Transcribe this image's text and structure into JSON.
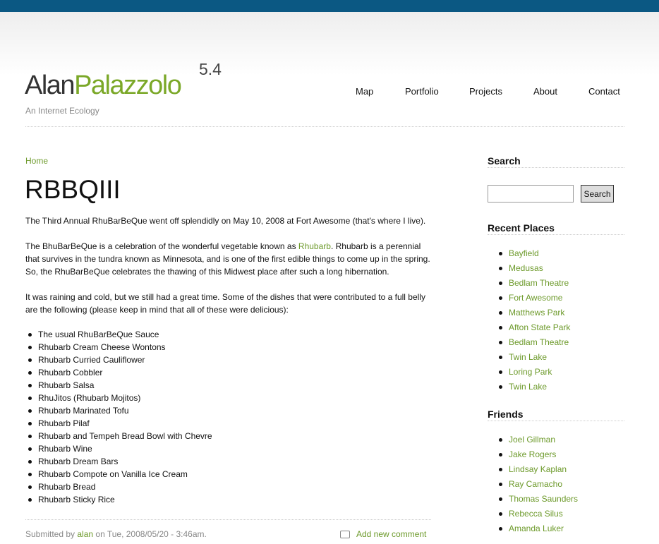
{
  "header": {
    "logo_first": "Alan",
    "logo_second": "Palazzolo",
    "version": "5.4",
    "tagline": "An Internet Ecology",
    "nav": [
      "Map",
      "Portfolio",
      "Projects",
      "About",
      "Contact"
    ]
  },
  "main": {
    "breadcrumb": "Home",
    "title": "RBBQIII",
    "para1": "The Third Annual RhuBarBeQue went off splendidly on May 10, 2008 at Fort Awesome (that's where I live).",
    "para2_before": "The BhuBarBeQue is a celebration of the wonderful vegetable known as ",
    "para2_link": "Rhubarb",
    "para2_after": ". Rhubarb is a perennial that survives in the tundra known as Minnesota, and is one of the first edible things to come up in the spring. So, the RhuBarBeQue celebrates the thawing of this Midwest place after such a long hibernation.",
    "para3": "It was raining and cold, but we still had a great time. Some of the dishes that were contributed to a full belly are the following (please keep in mind that all of these were delicious):",
    "dishes": [
      "The usual RhuBarBeQue Sauce",
      "Rhubarb Cream Cheese Wontons",
      "Rhubarb Curried Cauliflower",
      "Rhubarb Cobbler",
      "Rhubarb Salsa",
      "RhuJitos (Rhubarb Mojitos)",
      "Rhubarb Marinated Tofu",
      "Rhubarb Pilaf",
      "Rhubarb and Tempeh Bread Bowl with Chevre",
      "Rhubarb Wine",
      "Rhubarb Dream Bars",
      "Rhubarb Compote on Vanilla Ice Cream",
      "Rhubarb Bread",
      "Rhubarb Sticky Rice"
    ],
    "submitted_prefix": "Submitted by ",
    "submitted_author": "alan",
    "submitted_suffix": " on Tue, 2008/05/20 - 3:46am.",
    "add_comment": "Add new comment"
  },
  "sidebar": {
    "search_heading": "Search",
    "search_placeholder": "",
    "search_button": "Search",
    "recent_heading": "Recent Places",
    "recent_places": [
      "Bayfield",
      "Medusas",
      "Bedlam Theatre",
      "Fort Awesome",
      "Matthews Park",
      "Afton State Park",
      "Bedlam Theatre",
      "Twin Lake",
      "Loring Park",
      "Twin Lake"
    ],
    "friends_heading": "Friends",
    "friends": [
      "Joel Gillman",
      "Jake Rogers",
      "Lindsay Kaplan",
      "Ray Camacho",
      "Thomas Saunders",
      "Rebecca Silus",
      "Amanda Luker"
    ]
  },
  "colors": {
    "topbar": "#0b5883",
    "accent": "#7ba828",
    "link": "#6d9a2b"
  }
}
